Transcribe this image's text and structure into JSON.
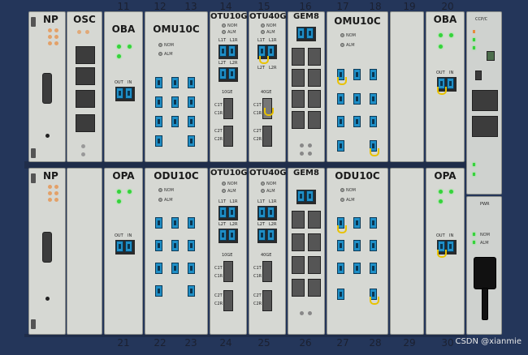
{
  "slots_top": [
    "11",
    "12",
    "13",
    "14",
    "15",
    "16",
    "17",
    "18",
    "19",
    "20"
  ],
  "slots_bottom": [
    "21",
    "22",
    "23",
    "24",
    "25",
    "26",
    "27",
    "28",
    "29",
    "30"
  ],
  "cards": {
    "np_top": "NP",
    "osc": "OSC",
    "oba_top": "OBA",
    "omu": "OMU10C",
    "otu10g_top": "OTU10G",
    "otu40g_top": "OTU40G",
    "gem8_top": "GEM8",
    "omu_2": "OMU10C",
    "oba_20": "OBA",
    "np_bot": "NP",
    "opa": "OPA",
    "odu": "ODU10C",
    "otu10g_bot": "OTU10G",
    "otu40g_bot": "OTU40G",
    "gem8_bot": "GEM8",
    "odu_2": "ODU10C",
    "opa_30": "OPA"
  },
  "labels": {
    "nom": "NOM",
    "alm": "ALM",
    "out": "OUT",
    "in": "IN",
    "l1t": "L1T",
    "l1r": "L1R",
    "l2t": "L2T",
    "l2r": "L2R",
    "g10": "10GE",
    "g40": "40GE",
    "c1t": "C1T",
    "c1r": "C1R",
    "c2t": "C2T",
    "c2r": "C2R",
    "ccpc": "CCP/C",
    "pwr": "PWR"
  },
  "watermark": "CSDN @xianmie"
}
